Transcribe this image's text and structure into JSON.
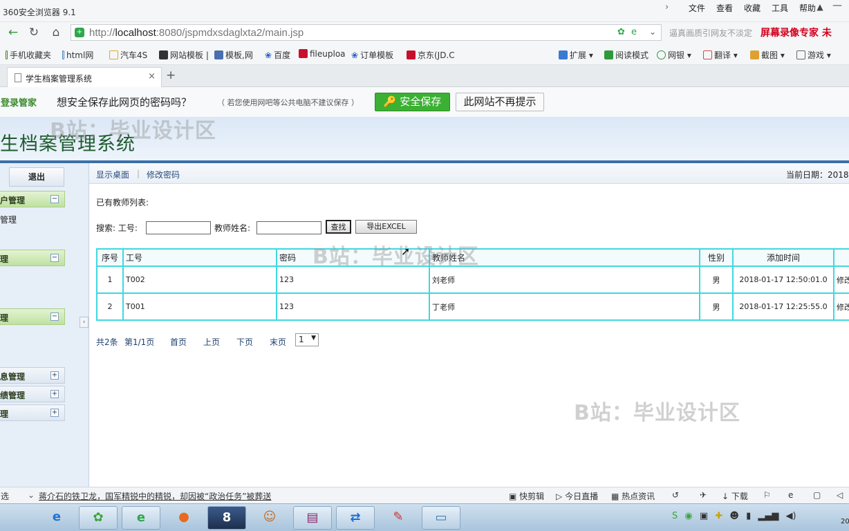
{
  "browser": {
    "app_title": "360安全浏览器 9.1",
    "menu": [
      "文件",
      "查看",
      "收藏",
      "工具",
      "帮助"
    ],
    "url_prefix": "http://",
    "url_host": "localhost",
    "url_rest": ":8080/jspmdxsdaglxta2/main.jsp",
    "search_hint": "逼真画质引网友不淡定",
    "recorder_label": "屏幕录像专家 未",
    "bookmarks": [
      "手机收藏夹",
      "html网",
      "汽车4S",
      "网站模板 |",
      "模板,网",
      "百度",
      "fileuploa",
      "订单模板",
      "京东(JD.C"
    ],
    "toolbar_right": [
      "扩展",
      "阅读模式",
      "网银",
      "翻译",
      "截图",
      "游戏"
    ],
    "tab_title": "学生档案管理系统",
    "colors": {
      "accent": "#3a6fa8",
      "brand_green": "#3cb033",
      "table_border": "#3fd8e0"
    }
  },
  "password_bar": {
    "label": "登录管家",
    "question": "想安全保存此网页的密码吗？",
    "note": "（ 若您使用网吧等公共电脑不建议保存 ）",
    "save_button": "安全保存",
    "never_button": "此网站不再提示"
  },
  "header": {
    "system_name": "生档案管理系统"
  },
  "sidebar": {
    "logout": "退出",
    "groups": [
      {
        "label": "户管理",
        "expanded": true,
        "items": [
          "管理"
        ]
      },
      {
        "label": "理",
        "expanded": true,
        "items": []
      },
      {
        "label": "理",
        "expanded": true,
        "items": []
      },
      {
        "label": "息管理",
        "expanded": false,
        "items": []
      },
      {
        "label": "绩管理",
        "expanded": false,
        "items": []
      },
      {
        "label": "理",
        "expanded": false,
        "items": []
      }
    ]
  },
  "subnav": {
    "links": [
      "显示桌面",
      "修改密码"
    ],
    "date_label": "当前日期：2018-"
  },
  "content": {
    "list_title": "已有教师列表:",
    "search_label": "搜索:",
    "field_id_label": "工号:",
    "field_name_label": "教师姓名:",
    "field_id_value": "",
    "field_name_value": "",
    "search_button": "查找",
    "export_button": "导出EXCEL",
    "table": {
      "columns": [
        "序号",
        "工号",
        "密码",
        "教师姓名",
        "性别",
        "添加时间",
        ""
      ],
      "rows": [
        [
          "1",
          "T002",
          "123",
          "刘老师",
          "男",
          "2018-01-17 12:50:01.0",
          "修改"
        ],
        [
          "2",
          "T001",
          "123",
          "丁老师",
          "男",
          "2018-01-17 12:25:55.0",
          "修改"
        ]
      ]
    },
    "pager": {
      "total": "共2条",
      "page": "第1/1页",
      "first": "首页",
      "prev": "上页",
      "next": "下页",
      "last": "末页",
      "select_value": "1"
    }
  },
  "watermark": "B站：毕业设计区",
  "statusbar": {
    "left": "选",
    "news": "蒋介石的铁卫龙，国军精锐中的精锐，却因被“政治任务”被葬送",
    "right": [
      "快剪辑",
      "今日直播",
      "热点资讯",
      "下载"
    ]
  },
  "taskbar": {
    "clock": "20"
  }
}
